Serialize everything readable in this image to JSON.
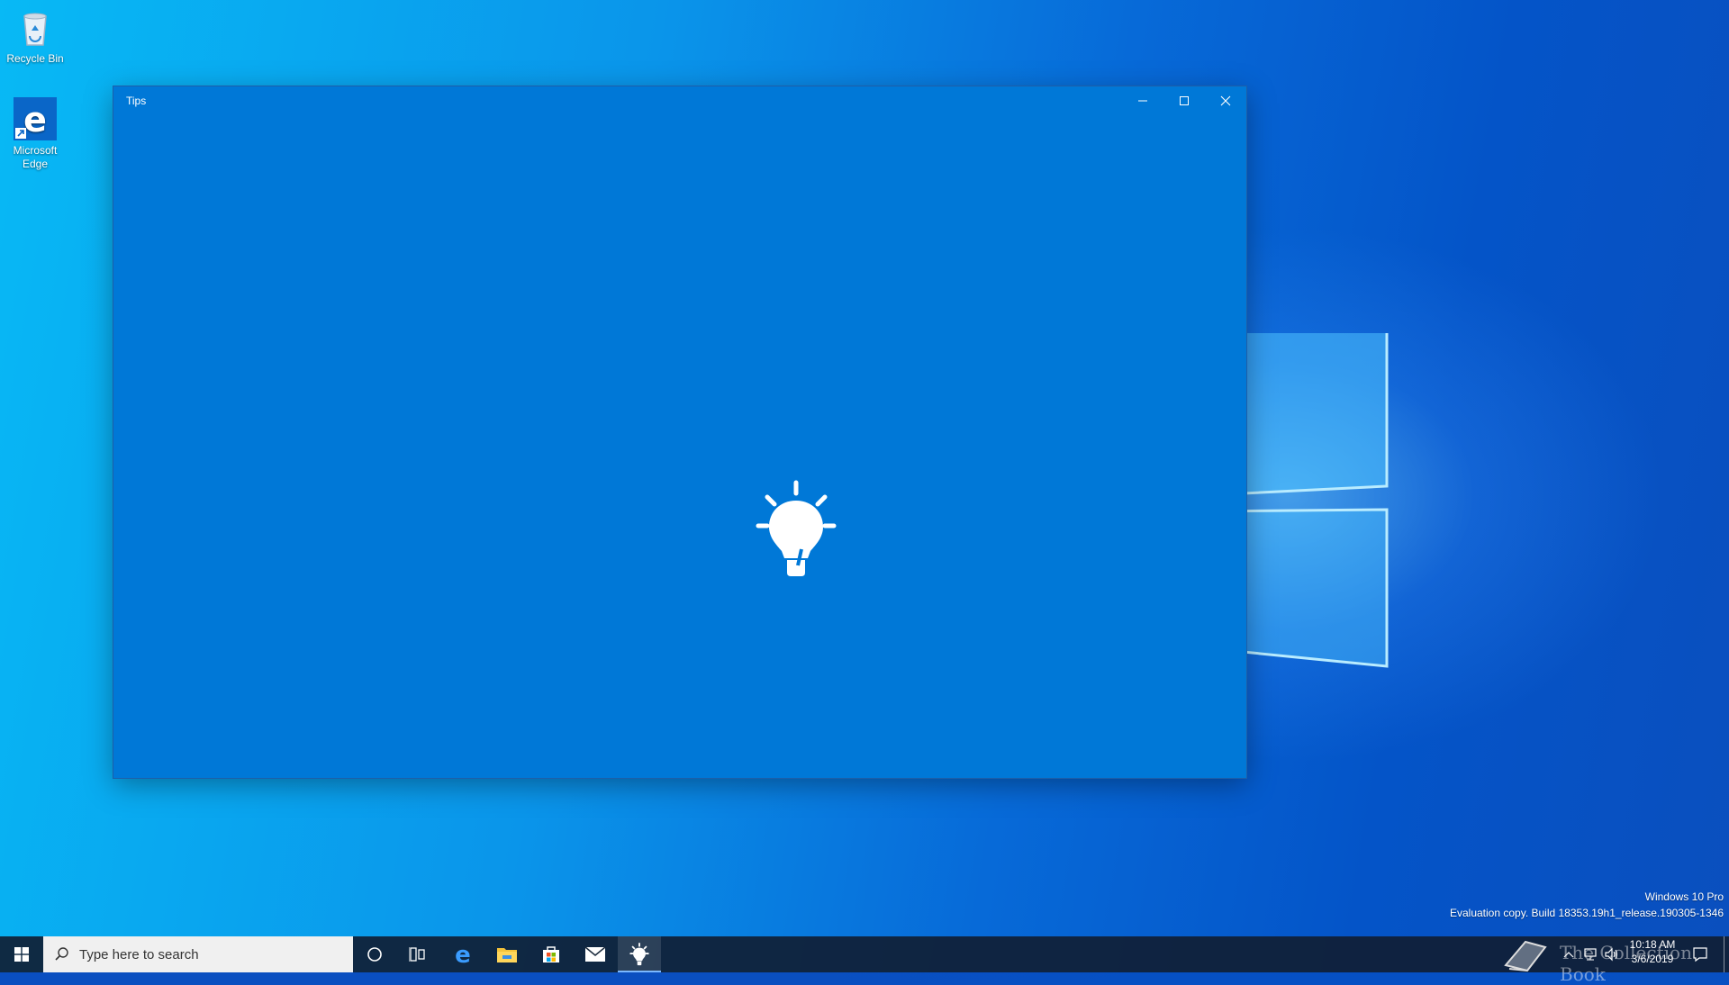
{
  "desktop": {
    "icons": [
      {
        "label": "Recycle Bin",
        "icon": "recycle-bin-icon"
      },
      {
        "label": "Microsoft Edge",
        "icon": "edge-icon"
      }
    ]
  },
  "window": {
    "title": "Tips",
    "splash_icon": "lightbulb-icon",
    "controls": [
      "minimize-icon",
      "maximize-icon",
      "close-icon"
    ],
    "background_color": "#0078d7"
  },
  "taskbar": {
    "search_placeholder": "Type here to search",
    "pinned": [
      "cortana-icon",
      "task-view-icon",
      "edge-icon",
      "file-explorer-icon",
      "store-icon",
      "mail-icon",
      "tips-icon"
    ],
    "active_app": "tips-icon"
  },
  "watermark": {
    "edition": "Windows 10 Pro",
    "build": "Evaluation copy. Build 18353.19h1_release.190305-1346"
  },
  "overlay_text": "The Collection Book",
  "tray": {
    "time": "10:18 AM",
    "date": "3/6/2019"
  }
}
